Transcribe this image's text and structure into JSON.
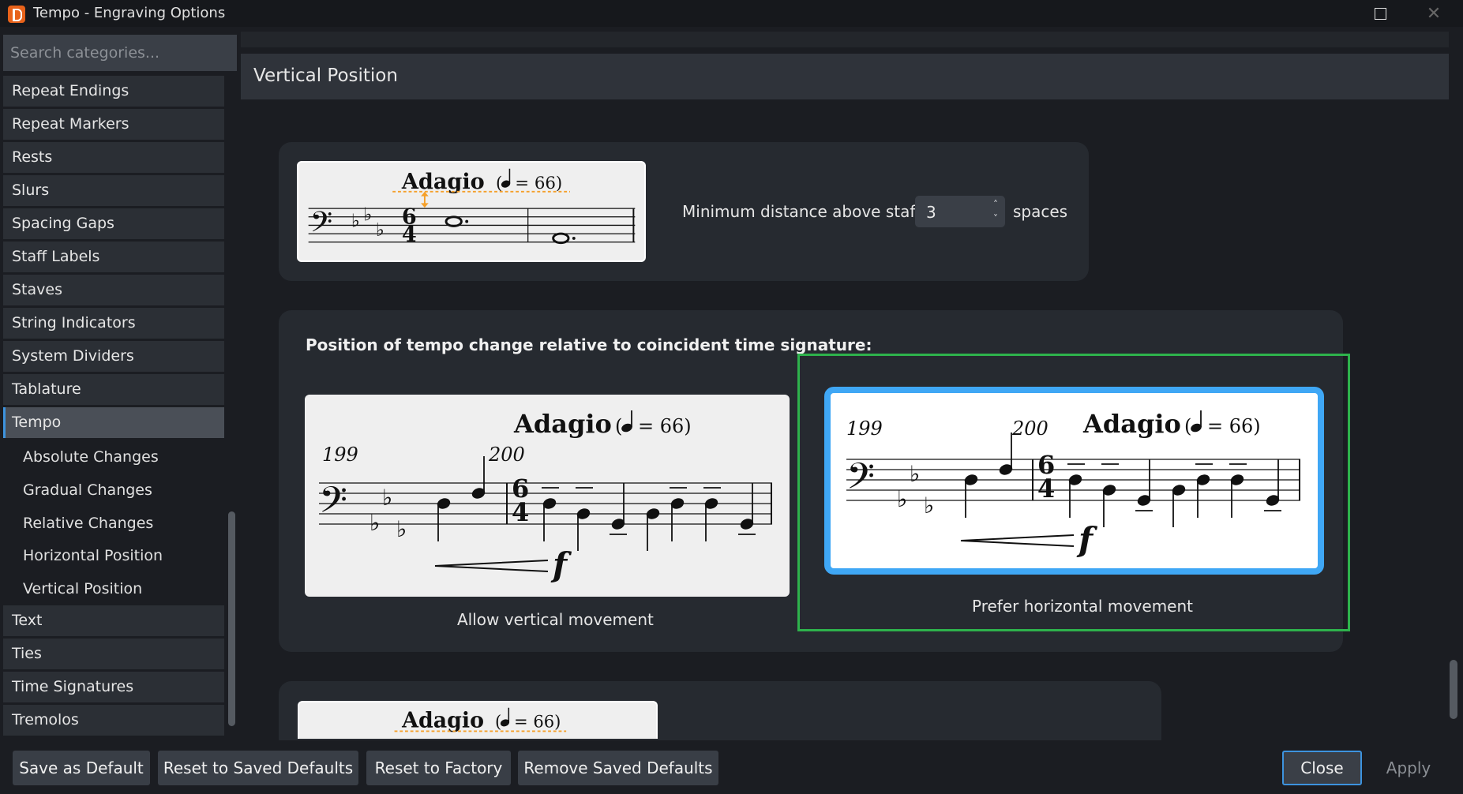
{
  "window": {
    "title": "Tempo - Engraving Options"
  },
  "sidebar": {
    "search_placeholder": "Search categories...",
    "categories": [
      "Repeat Endings",
      "Repeat Markers",
      "Rests",
      "Slurs",
      "Spacing Gaps",
      "Staff Labels",
      "Staves",
      "String Indicators",
      "System Dividers",
      "Tablature",
      "Tempo",
      "Text",
      "Ties",
      "Time Signatures",
      "Tremolos"
    ],
    "selected": "Tempo",
    "subitems": [
      "Absolute Changes",
      "Gradual Changes",
      "Relative Changes",
      "Horizontal Position",
      "Vertical Position"
    ]
  },
  "section": {
    "title": "Vertical Position"
  },
  "min_distance": {
    "label": "Minimum distance above staff:",
    "value": "3",
    "unit": "spaces"
  },
  "tempo_position": {
    "heading": "Position of tempo change relative to coincident time signature:",
    "options": [
      {
        "label": "Allow vertical movement",
        "selected": false
      },
      {
        "label": "Prefer horizontal movement",
        "selected": true
      }
    ]
  },
  "notation": {
    "tempo_text": "Adagio",
    "metronome": "= 66)",
    "open_paren": "(",
    "bar_a": "199",
    "bar_b": "200",
    "dynamic": "f"
  },
  "footer": {
    "buttons": [
      "Save as Default",
      "Reset to Saved Defaults",
      "Reset to Factory",
      "Remove Saved Defaults"
    ],
    "close": "Close",
    "apply": "Apply"
  },
  "colors": {
    "accent": "#3d93de",
    "selection": "#2eb24c",
    "highlight": "#3fa7f5"
  }
}
